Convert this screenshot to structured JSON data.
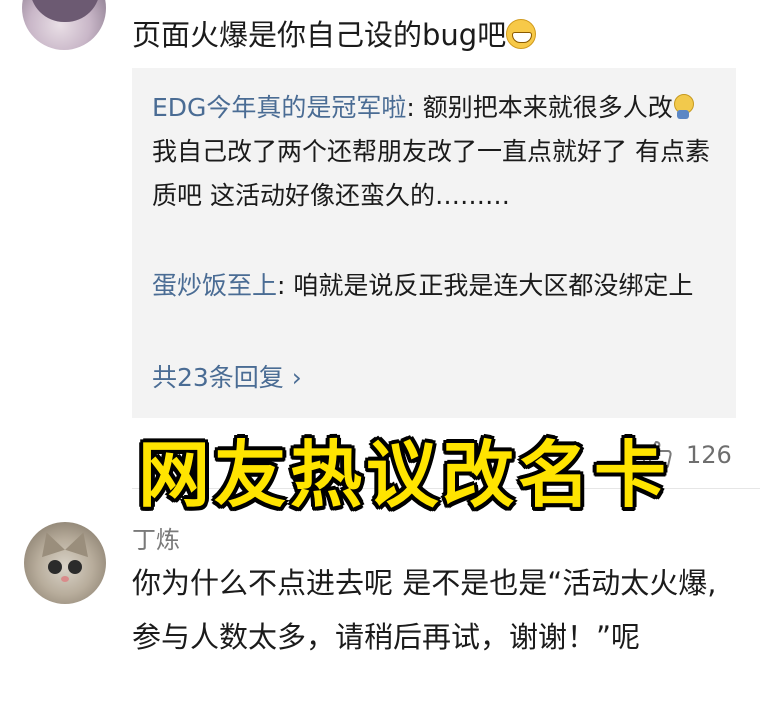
{
  "comment_top": {
    "text": "页面火爆是你自己设的bug吧"
  },
  "replies": [
    {
      "author": "EDG今年真的是冠军啦",
      "text_part1": ": 额别把本来就很多人改",
      "text_part2": " 我自己改了两个还帮朋友改了一直点就好了 有点素质吧 这活动好像还蛮久的………"
    },
    {
      "author": "蛋炒饭至上",
      "text": ": 咱就是说反正我是连大区都没绑定上"
    }
  ],
  "reply_more": "共23条回复 ›",
  "like": {
    "count": "126"
  },
  "overlay_title": "网友热议改名卡",
  "comment_second": {
    "username": "丁炼",
    "text": "你为什么不点进去呢 是不是也是“活动太火爆,参与人数太多，请稍后再试，谢谢！”呢"
  }
}
